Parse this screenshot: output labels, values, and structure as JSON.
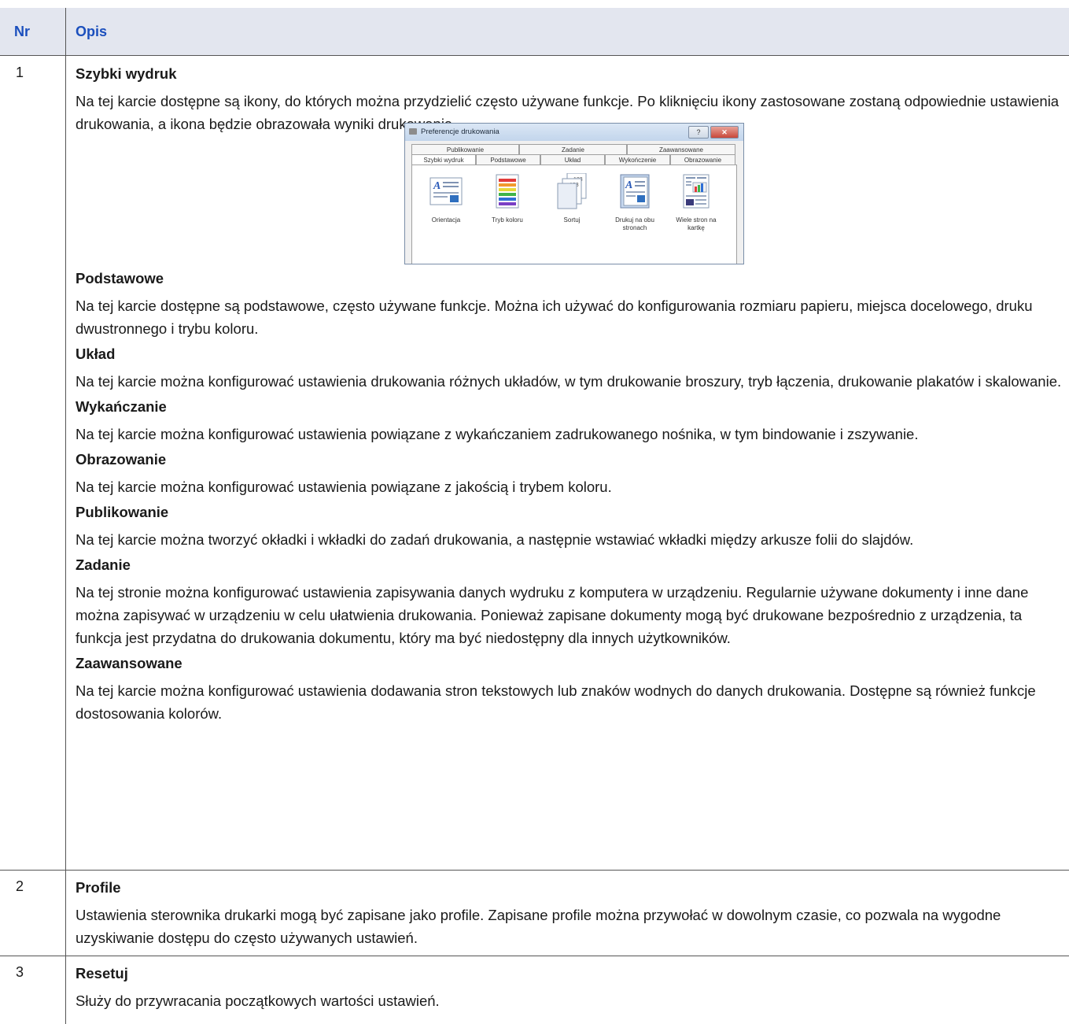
{
  "header": {
    "col_number": "Nr",
    "col_description": "Opis"
  },
  "rows": [
    {
      "number": "1",
      "sections": [
        {
          "title": "Szybki wydruk",
          "text": "Na tej karcie dostępne są ikony, do których można przydzielić często używane funkcje. Po kliknięciu ikony zastosowane zostaną odpowiednie ustawienia drukowania, a ikona będzie obrazowała wyniki drukowania."
        },
        {
          "title": "Podstawowe",
          "text": "Na tej karcie dostępne są podstawowe, często używane funkcje. Można ich używać do konfigurowania rozmiaru papieru, miejsca docelowego, druku dwustronnego i trybu koloru."
        },
        {
          "title": "Układ",
          "text": "Na tej karcie można konfigurować ustawienia drukowania różnych układów, w tym drukowanie broszury, tryb łączenia, drukowanie plakatów i skalowanie."
        },
        {
          "title": "Wykańczanie",
          "text": "Na tej karcie można konfigurować ustawienia powiązane z wykańczaniem zadrukowanego nośnika, w tym bindowanie i zszywanie."
        },
        {
          "title": "Obrazowanie",
          "text": "Na tej karcie można konfigurować ustawienia powiązane z jakością i trybem koloru."
        },
        {
          "title": "Publikowanie",
          "text": "Na tej karcie można tworzyć okładki i wkładki do zadań drukowania, a następnie wstawiać wkładki między arkusze folii do slajdów."
        },
        {
          "title": "Zadanie",
          "text": "Na tej stronie można konfigurować ustawienia zapisywania danych wydruku z komputera w urządzeniu. Regularnie używane dokumenty i inne dane można zapisywać w urządzeniu w celu ułatwienia drukowania. Ponieważ zapisane dokumenty mogą być drukowane bezpośrednio z urządzenia, ta funkcja jest przydatna do drukowania dokumentu, który ma być niedostępny dla innych użytkowników."
        },
        {
          "title": "Zaawansowane",
          "text": "Na tej karcie można konfigurować ustawienia dodawania stron tekstowych lub znaków wodnych do danych drukowania. Dostępne są również funkcje dostosowania kolorów."
        }
      ]
    },
    {
      "number": "2",
      "title": "Profile",
      "text": "Ustawienia sterownika drukarki mogą być zapisane jako profile. Zapisane profile można przywołać w dowolnym czasie, co pozwala na wygodne uzyskiwanie dostępu do często używanych ustawień."
    },
    {
      "number": "3",
      "title": "Resetuj",
      "text": "Służy do przywracania początkowych wartości ustawień."
    }
  ],
  "dialog": {
    "title": "Preferencje drukowania",
    "help_label": "?",
    "close_label": "✕",
    "tabs_back": [
      "Publikowanie",
      "Zadanie",
      "Zaawansowane"
    ],
    "tabs_front": [
      "Szybki wydruk",
      "Podstawowe",
      "Układ",
      "Wykończenie",
      "Obrazowanie"
    ],
    "active_tab": "Szybki wydruk",
    "items": [
      {
        "label": "Orientacja",
        "icon": "orientation-icon"
      },
      {
        "label": "Tryb koloru",
        "icon": "color-mode-icon"
      },
      {
        "label": "Sortuj",
        "icon": "collate-icon"
      },
      {
        "label": "Drukuj na obu stronach",
        "icon": "duplex-icon"
      },
      {
        "label": "Wiele stron na kartkę",
        "icon": "multiple-pages-icon"
      }
    ]
  }
}
